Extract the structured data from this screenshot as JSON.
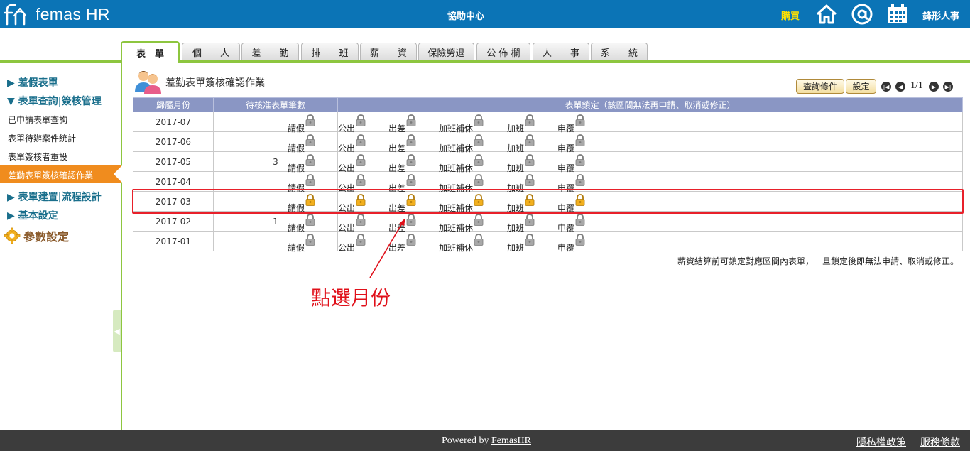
{
  "header": {
    "logo_text": "femas HR",
    "help_center": "協助中心",
    "buy": "購買",
    "company": "鋒形人事"
  },
  "tabs": [
    "表　單",
    "個　　人",
    "差　　勤",
    "排　　班",
    "薪　　資",
    "保險勞退",
    "公 佈 欄",
    "人　　事",
    "系　　統"
  ],
  "sidebar": {
    "cat_leave": "▶ 差假表單",
    "cat_query": "▼ 表單查詢|簽核管理",
    "items": [
      "已申請表單查詢",
      "表單待辦案件統計",
      "表單簽核者重設"
    ],
    "active_item": "差勤表單簽核確認作業",
    "cat_build": "▶ 表單建置|流程設計",
    "cat_basic": "▶ 基本設定",
    "param": "參數設定"
  },
  "main": {
    "title": "差勤表單簽核確認作業",
    "query_btn": "查詢條件",
    "settings_btn": "設定",
    "page_indicator": "1/1",
    "columns": [
      "歸屬月份",
      "待核准表單筆數",
      "表單鎖定（該區間無法再申請、取消或修正）"
    ],
    "lock_labels": [
      "請假",
      "公出",
      "出差",
      "加班補休",
      "加班",
      "申覆"
    ],
    "rows": [
      {
        "month": "2017-07",
        "pending": "",
        "locked": false
      },
      {
        "month": "2017-06",
        "pending": "",
        "locked": false
      },
      {
        "month": "2017-05",
        "pending": "3",
        "locked": false
      },
      {
        "month": "2017-04",
        "pending": "",
        "locked": false
      },
      {
        "month": "2017-03",
        "pending": "",
        "locked": true
      },
      {
        "month": "2017-02",
        "pending": "1",
        "locked": false
      },
      {
        "month": "2017-01",
        "pending": "",
        "locked": false
      }
    ],
    "note": "薪資結算前可鎖定對應區間內表單，一旦鎖定後即無法申請、取消或修正。",
    "annotation": "點選月份"
  },
  "colors": {
    "header_bg": "#0b74b6",
    "accent_green": "#8dc63f",
    "active_orange": "#f08c1e",
    "table_header": "#8a96c4",
    "highlight_red": "#e8202a",
    "lock_gold": "#f2b01e",
    "lock_gray": "#a8a8a8"
  },
  "footer": {
    "powered_prefix": "Powered by ",
    "powered_link": "FemasHR",
    "privacy": "隱私權政策",
    "terms": "服務條款"
  }
}
